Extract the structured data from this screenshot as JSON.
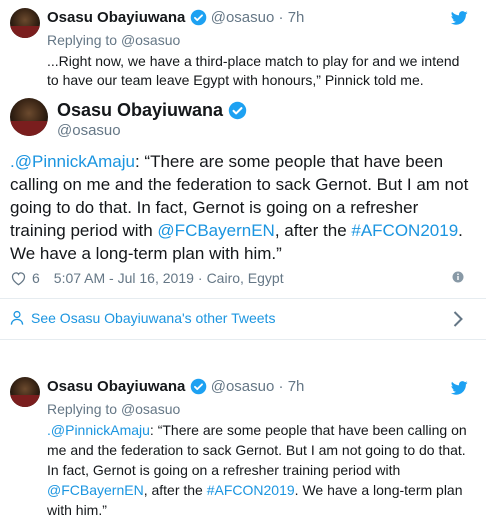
{
  "colors": {
    "verified": "#1da1f2",
    "link": "#1b95e0",
    "muted": "#657786"
  },
  "tweet1": {
    "name": "Osasu Obayiuwana",
    "handle": "@osasuo",
    "sep": "·",
    "time": "7h",
    "replying_prefix": "Replying to ",
    "replying_to": "@osasuo",
    "text": "...Right now, we have a third-place match to play for and we intend to have our team leave Egypt with honours,” Pinnick told me."
  },
  "main": {
    "name": "Osasu Obayiuwana",
    "handle": "@osasuo",
    "text_parts": [
      {
        "t": ".@PinnickAmaju",
        "link": true
      },
      {
        "t": ": “There are some people that have been calling on me and the federation to sack Gernot. But I am not going to do that. In fact, Gernot is going on a refresher training period with ",
        "link": false
      },
      {
        "t": "@FCBayernEN",
        "link": true
      },
      {
        "t": ", after the ",
        "link": false
      },
      {
        "t": "#AFCON2019",
        "link": true
      },
      {
        "t": ". We have a long-term plan with him.”",
        "link": false
      }
    ],
    "likes": "6",
    "timestamp": "5:07 AM - Jul 16, 2019",
    "sep": "·",
    "location": "Cairo, Egypt"
  },
  "see_other": "See Osasu Obayiuwana's other Tweets",
  "tweet3": {
    "name": "Osasu Obayiuwana",
    "handle": "@osasuo",
    "sep": "·",
    "time": "7h",
    "replying_prefix": "Replying to ",
    "replying_to": "@osasuo",
    "text_parts": [
      {
        "t": ".@PinnickAmaju",
        "link": true
      },
      {
        "t": ": “There are some people that have been calling on me and the federation to sack Gernot. But I am not going to do that. In fact, Gernot is going on a refresher training period with ",
        "link": false
      },
      {
        "t": "@FCBayernEN",
        "link": true
      },
      {
        "t": ", after the ",
        "link": false
      },
      {
        "t": "#AFCON2019",
        "link": true
      },
      {
        "t": ". We have a long-term plan with him.”",
        "link": false
      }
    ]
  }
}
